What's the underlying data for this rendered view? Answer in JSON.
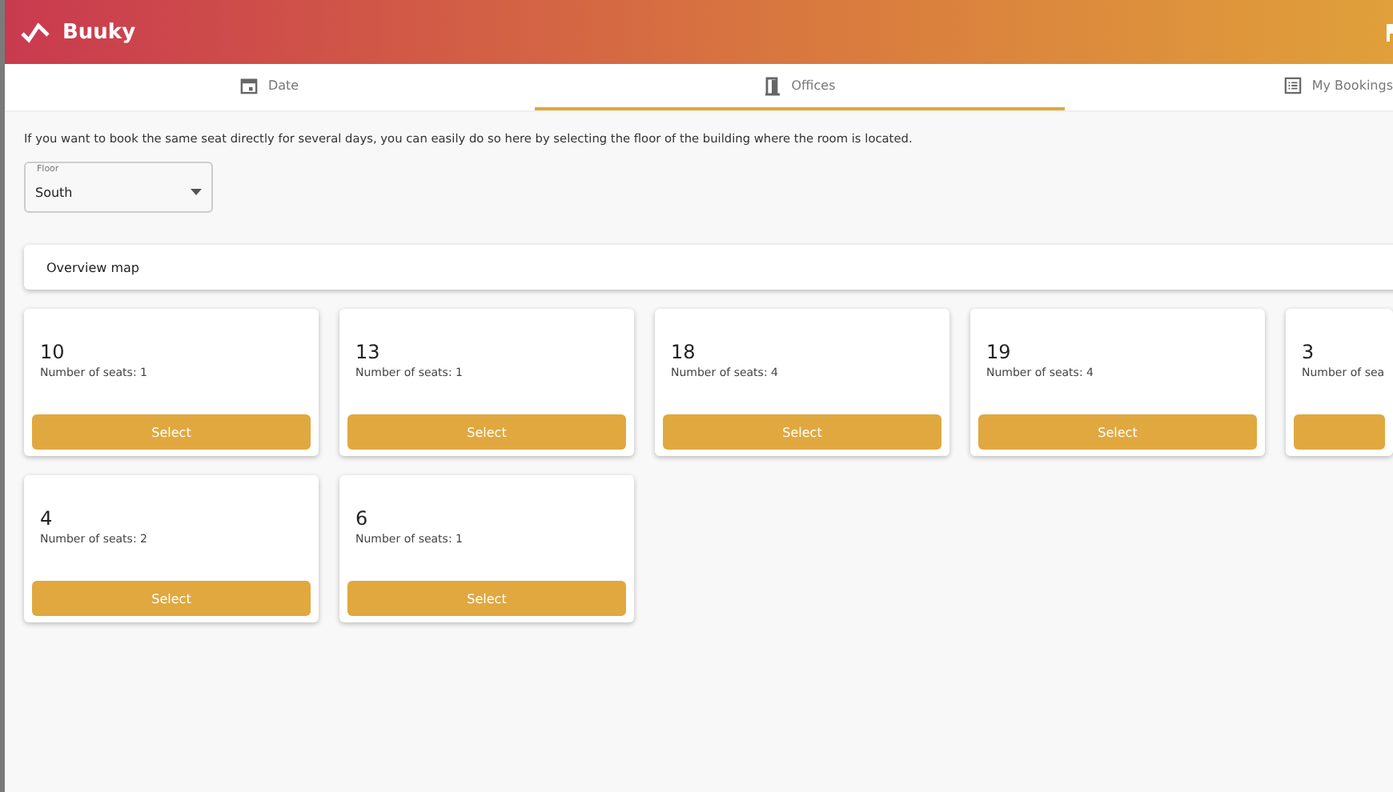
{
  "app": {
    "title": "Buuky"
  },
  "tabs": [
    {
      "label": "Date",
      "kind": "calendar",
      "selected": false
    },
    {
      "label": "Offices",
      "kind": "door",
      "selected": true
    },
    {
      "label": "My Bookings",
      "kind": "list",
      "selected": false
    }
  ],
  "intro": "If you want to book the same seat directly for several days, you can easily do so here by selecting the floor of the building where the room is located.",
  "floor_select": {
    "label": "Floor",
    "value": "South"
  },
  "overview": {
    "label": "Overview map"
  },
  "rooms": [
    {
      "name": "10",
      "seats": "Number of seats: 1",
      "button": "Select"
    },
    {
      "name": "13",
      "seats": "Number of seats: 1",
      "button": "Select"
    },
    {
      "name": "18",
      "seats": "Number of seats: 4",
      "button": "Select"
    },
    {
      "name": "19",
      "seats": "Number of seats: 4",
      "button": "Select"
    },
    {
      "name": "3",
      "seats": "Number of sea"
    },
    {
      "name": "4",
      "seats": "Number of seats: 2",
      "button": "Select"
    },
    {
      "name": "6",
      "seats": "Number of seats: 1",
      "button": "Select"
    }
  ]
}
